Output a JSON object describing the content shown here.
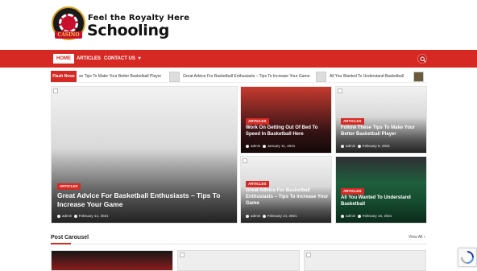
{
  "site": {
    "tagline": "Feel the Royalty Here",
    "name": "Schooling",
    "logo_text": "CASINO"
  },
  "nav": {
    "home": "HOME",
    "articles": "ARTICLES",
    "contact": "CONTACT US",
    "contact_caret": "▾"
  },
  "flash_news": {
    "label": "Flash News",
    "items": [
      "se Tips To Make Your Better Basketball Player",
      "Great Advice For Basketball Enthusiasts – Tips To Increase Your Game",
      "All You Wanted To Understand Basketball"
    ]
  },
  "featured": {
    "big": {
      "category": "ARTICLES",
      "title": "Great Advice For Basketball Enthusiasts – Tips To Increase Your Game",
      "author": "admin",
      "date": "February 14, 2021"
    },
    "tiles": [
      {
        "category": "ARTICLES",
        "title": "Work On Getting Out Of Bed To Speed In Basketball Here",
        "author": "admin",
        "date": "January 11, 2021"
      },
      {
        "category": "ARTICLES",
        "title": "Follow These Tips To Make Your Better Basketball Player",
        "author": "admin",
        "date": "February 5, 2021"
      },
      {
        "category": "ARTICLES",
        "title": "Great Advice For Basketball Enthusiasts – Tips To Increase Your Game",
        "author": "admin",
        "date": "February 14, 2021"
      },
      {
        "category": "ARTICLES",
        "title": "All You Wanted To Understand Basketball",
        "author": "admin",
        "date": "February 16, 2021"
      }
    ]
  },
  "carousel": {
    "title": "Post Carousel",
    "view_all": "View All",
    "view_all_arrow": "›"
  },
  "colors": {
    "accent": "#d72924",
    "logo_gold": "#d5a11c"
  },
  "icons": {
    "search": "search-icon",
    "author": "user-icon",
    "date": "clock-icon",
    "recaptcha": "recaptcha-icon"
  }
}
